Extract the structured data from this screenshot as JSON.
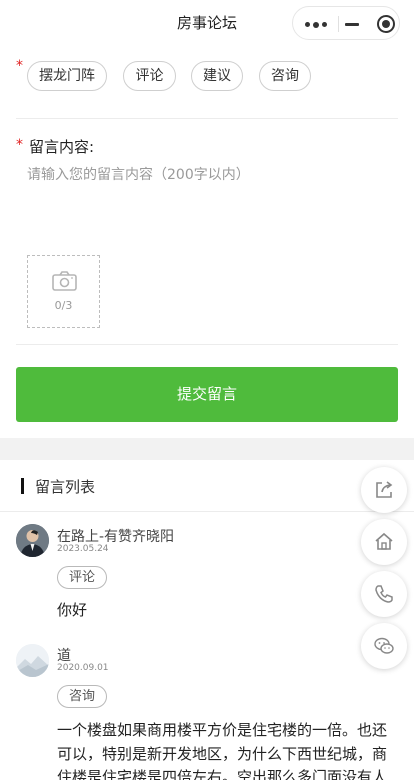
{
  "topbar": {
    "title": "房事论坛",
    "more_icon": "more-dots-icon",
    "minimize_icon": "minus-icon",
    "close_icon": "target-circle-icon"
  },
  "form": {
    "required_mark": "*",
    "categories": [
      "摆龙门阵",
      "评论",
      "建议",
      "咨询"
    ],
    "content_label": "留言内容:",
    "content_placeholder": "请输入您的留言内容（200字以内）",
    "upload_count": "0/3",
    "upload_icon": "camera-icon",
    "submit_label": "提交留言",
    "submit_color": "#4fbb3c"
  },
  "list": {
    "title": "留言列表",
    "comments": [
      {
        "name": "在路上-有赞齐晓阳",
        "date": "2023.05.24",
        "tag": "评论",
        "text": "你好"
      },
      {
        "name": "道",
        "date": "2020.09.01",
        "tag": "咨询",
        "text_lines": [
          "一个楼盘如果商用楼平方价是住宅楼的一倍。也还",
          "可以，特别是新开发地区，为什么下西世纪城，商",
          "住楼是住宅楼是四倍左右。空出那么多门面没有人"
        ]
      }
    ]
  },
  "floating": [
    "share-icon",
    "home-icon",
    "phone-icon",
    "wechat-icon"
  ]
}
